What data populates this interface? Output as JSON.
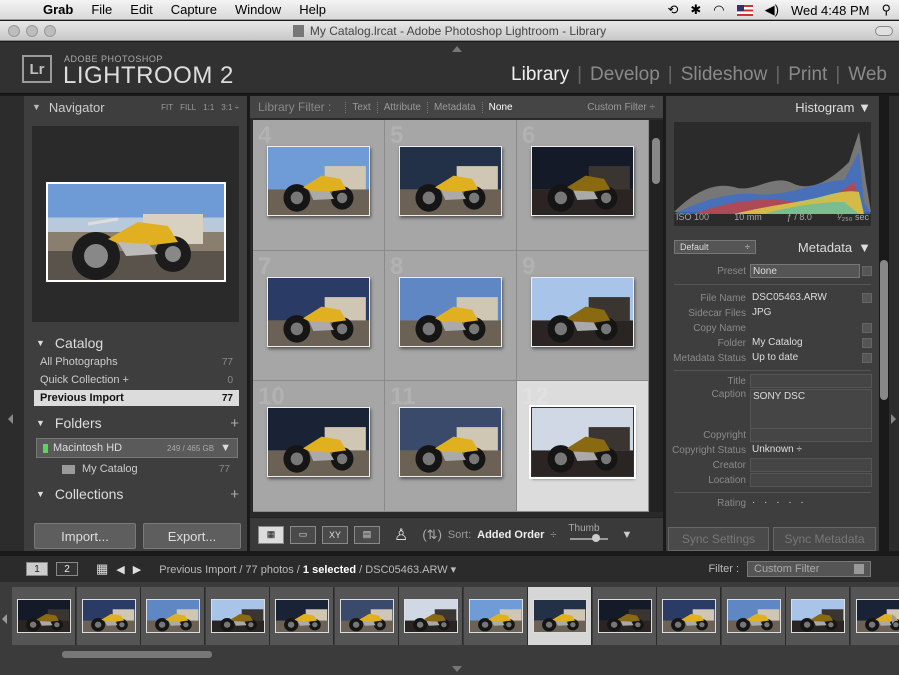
{
  "menubar": {
    "items": [
      "Grab",
      "File",
      "Edit",
      "Capture",
      "Window",
      "Help"
    ],
    "clock": "Wed 4:48 PM"
  },
  "window": {
    "title": "My Catalog.lrcat - Adobe Photoshop Lightroom - Library"
  },
  "identity": {
    "small": "ADOBE PHOTOSHOP",
    "big": "LIGHTROOM 2",
    "logo": "Lr"
  },
  "modules": [
    "Library",
    "Develop",
    "Slideshow",
    "Print",
    "Web"
  ],
  "active_module": "Library",
  "navigator": {
    "title": "Navigator",
    "options": [
      "FIT",
      "FILL",
      "1:1",
      "3:1 ÷"
    ]
  },
  "catalog": {
    "title": "Catalog",
    "items": [
      {
        "label": "All Photographs",
        "count": "77"
      },
      {
        "label": "Quick Collection +",
        "count": "0"
      },
      {
        "label": "Previous Import",
        "count": "77"
      }
    ]
  },
  "folders": {
    "title": "Folders",
    "volume": {
      "label": "Macintosh HD",
      "size": "249 / 465 GB"
    },
    "folder": {
      "label": "My Catalog",
      "count": "77"
    }
  },
  "collections": {
    "title": "Collections"
  },
  "left_buttons": {
    "import": "Import...",
    "export": "Export..."
  },
  "library_filter": {
    "label": "Library Filter :",
    "options": [
      "Text",
      "Attribute",
      "Metadata",
      "None"
    ],
    "active": "None",
    "custom": "Custom Filter ÷"
  },
  "grid": {
    "cells": [
      {
        "num": "4"
      },
      {
        "num": "5"
      },
      {
        "num": "6"
      },
      {
        "num": "7"
      },
      {
        "num": "8"
      },
      {
        "num": "9"
      },
      {
        "num": "10"
      },
      {
        "num": "11"
      },
      {
        "num": "12"
      }
    ],
    "selected_index": 8
  },
  "toolbar": {
    "sort_label": "Sort:",
    "sort_value": "Added Order",
    "thumb_label": "Thumb",
    "view_icons": [
      "grid-view-icon",
      "loupe-view-icon",
      "compare-view-icon",
      "survey-view-icon"
    ]
  },
  "histogram": {
    "title": "Histogram",
    "iso": "ISO 100",
    "focal": "10 mm",
    "aperture": "ƒ / 8.0",
    "shutter": "¹⁄₂₅₀ sec"
  },
  "metadata": {
    "title": "Metadata",
    "preset_drop": "Default",
    "rows": [
      {
        "key": "Preset",
        "value": "None"
      },
      {
        "key": "File Name",
        "value": "DSC05463.ARW"
      },
      {
        "key": "Sidecar Files",
        "value": "JPG"
      },
      {
        "key": "Copy Name",
        "value": ""
      },
      {
        "key": "Folder",
        "value": "My Catalog"
      },
      {
        "key": "Metadata Status",
        "value": "Up to date"
      },
      {
        "key": "Title",
        "value": ""
      },
      {
        "key": "Caption",
        "value": "SONY DSC"
      },
      {
        "key": "Copyright",
        "value": ""
      },
      {
        "key": "Copyright Status",
        "value": "Unknown ÷"
      },
      {
        "key": "Creator",
        "value": ""
      },
      {
        "key": "Location",
        "value": ""
      },
      {
        "key": "Rating",
        "value": "· · · · ·"
      }
    ]
  },
  "sync": {
    "settings": "Sync Settings",
    "metadata": "Sync Metadata"
  },
  "filmbar": {
    "screen1": "1",
    "screen2": "2",
    "path_source": "Previous Import",
    "path_count": " / 77 photos / ",
    "path_selected": "1 selected",
    "path_file": " / DSC05463.ARW ▾",
    "filter_label": "Filter :",
    "filter_value": "Custom Filter"
  },
  "colors": {
    "panel": "#3e3e3e",
    "grid_cell": "#a6a6a6",
    "selected_cell": "#dcdcdc",
    "accent_text": "#f0f0f0"
  }
}
